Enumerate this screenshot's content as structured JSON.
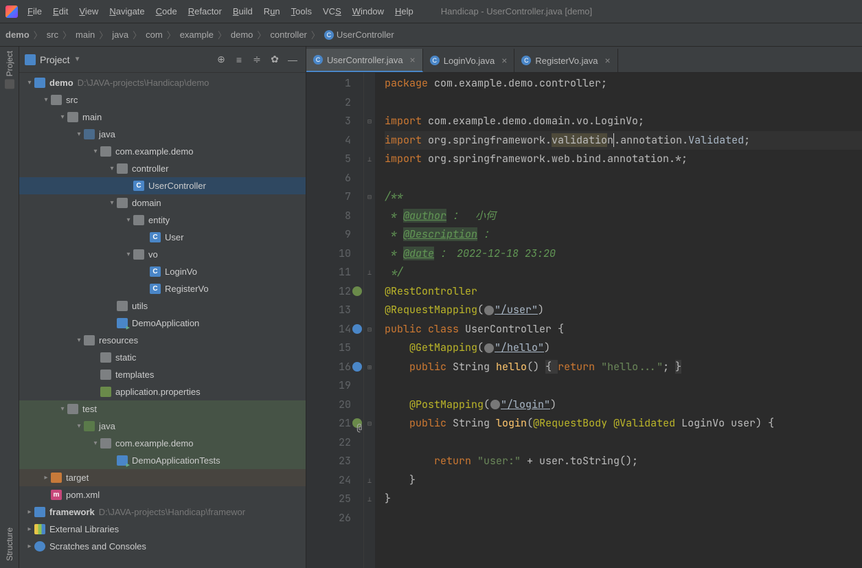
{
  "window_title": "Handicap - UserController.java [demo]",
  "menu": [
    "File",
    "Edit",
    "View",
    "Navigate",
    "Code",
    "Refactor",
    "Build",
    "Run",
    "Tools",
    "VCS",
    "Window",
    "Help"
  ],
  "breadcrumbs": [
    "demo",
    "src",
    "main",
    "java",
    "com",
    "example",
    "demo",
    "controller",
    "UserController"
  ],
  "sidebar": {
    "title": "Project",
    "tree": {
      "demo": {
        "label": "demo",
        "path": "D:\\JAVA-projects\\Handicap\\demo"
      },
      "src": "src",
      "main": "main",
      "java": "java",
      "pkg": "com.example.demo",
      "controller": "controller",
      "usercontroller": "UserController",
      "domain": "domain",
      "entity": "entity",
      "user": "User",
      "vo": "vo",
      "loginvo": "LoginVo",
      "registervo": "RegisterVo",
      "utils": "utils",
      "demoapp": "DemoApplication",
      "resources": "resources",
      "static": "static",
      "templates": "templates",
      "appprops": "application.properties",
      "test": "test",
      "testjava": "java",
      "testpkg": "com.example.demo",
      "demotests": "DemoApplicationTests",
      "target": "target",
      "pom": "pom.xml",
      "framework": {
        "label": "framework",
        "path": "D:\\JAVA-projects\\Handicap\\framewor"
      },
      "extlibs": "External Libraries",
      "scratches": "Scratches and Consoles"
    }
  },
  "tabs": [
    {
      "label": "UserController.java",
      "active": true
    },
    {
      "label": "LoginVo.java",
      "active": false
    },
    {
      "label": "RegisterVo.java",
      "active": false
    }
  ],
  "left_tabs": [
    "Project",
    "Structure"
  ],
  "code": {
    "l1": {
      "kw": "package",
      "rest": " com.example.demo.controller;"
    },
    "l3": {
      "kw": "import",
      "rest": " com.example.demo.domain.vo.LoginVo;"
    },
    "l4": {
      "kw": "import",
      "p1": " org.springframework.",
      "hl": "validatio",
      "caret": "n",
      "p2": ".annotation.",
      "v": "Validated",
      "semi": ";"
    },
    "l5": {
      "kw": "import",
      "rest": " org.springframework.web.bind.annotation.*;"
    },
    "l7": "/**",
    "l8": {
      "star": " * ",
      "tag": "@author",
      "rest": " ：  小何"
    },
    "l9": {
      "star": " * ",
      "tag": "@Description",
      "rest": " ："
    },
    "l10": {
      "star": " * ",
      "tag": "@date",
      "rest": " ： 2022-12-18 23:20"
    },
    "l11": " */",
    "l12": "@RestController",
    "l13": {
      "a": "@RequestMapping",
      "p": "(",
      "url": "\"/user\"",
      "c": ")"
    },
    "l14": {
      "kw1": "public ",
      "kw2": "class ",
      "cls": "UserController ",
      "br": "{"
    },
    "l15": {
      "a": "@GetMapping",
      "p": "(",
      "url": "\"/hello\"",
      "c": ")"
    },
    "l16": {
      "kw": "public ",
      "t": "String ",
      "m": "hello",
      "p": "() ",
      "b1": "{ ",
      "kw2": "return ",
      "s": "\"hello...\"",
      "semi": "; ",
      "b2": "}"
    },
    "l20": {
      "a": "@PostMapping",
      "p": "(",
      "url": "\"/login\"",
      "c": ")"
    },
    "l21": {
      "kw": "public ",
      "t": "String ",
      "m": "login",
      "p": "(",
      "a1": "@RequestBody ",
      "a2": "@Validated ",
      "tp": "LoginVo ",
      "v": "user",
      "c": ") {"
    },
    "l23": {
      "kw": "return ",
      "s": "\"user:\"",
      "rest": " + user.toString();"
    },
    "l24": "    }",
    "l25": "}"
  }
}
